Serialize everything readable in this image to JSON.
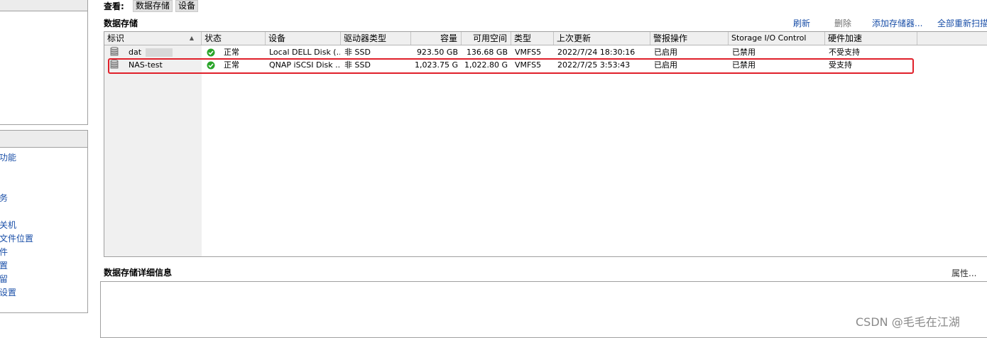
{
  "view_bar": {
    "label": "查看:",
    "tabs": [
      "数据存储",
      "设备"
    ]
  },
  "section_title": "数据存储",
  "toolbar": {
    "refresh": "刷新",
    "delete": "删除",
    "add_storage": "添加存储器...",
    "rescan_all": "全部重新扫描"
  },
  "left_nav": {
    "items": [
      "功能",
      "务",
      "关机",
      "文件位置",
      "件",
      "置",
      "留",
      "设置"
    ]
  },
  "table": {
    "columns": [
      "标识",
      "状态",
      "设备",
      "驱动器类型",
      "容量",
      "可用空间",
      "类型",
      "上次更新",
      "警报操作",
      "Storage I/O Control",
      "硬件加速"
    ],
    "rows": [
      {
        "id": "dat",
        "status": "正常",
        "device": "Local DELL Disk (...",
        "drive_type": "非 SSD",
        "capacity": "923.50 GB",
        "free": "136.68 GB",
        "type": "VMFS5",
        "last_update": "2022/7/24 18:30:16",
        "alarm": "已启用",
        "sioc": "已禁用",
        "hw_accel": "不受支持"
      },
      {
        "id": "NAS-test",
        "status": "正常",
        "device": "QNAP iSCSI Disk ...",
        "drive_type": "非 SSD",
        "capacity": "1,023.75 G",
        "free": "1,022.80 G",
        "type": "VMFS5",
        "last_update": "2022/7/25 3:53:43",
        "alarm": "已启用",
        "sioc": "已禁用",
        "hw_accel": "受支持"
      }
    ]
  },
  "details": {
    "title": "数据存储详细信息",
    "properties": "属性..."
  },
  "watermark": "CSDN @毛毛在江湖",
  "colors": {
    "link": "#1a4fa8",
    "highlight": "#e0202a",
    "ok_green": "#2aa52a"
  }
}
